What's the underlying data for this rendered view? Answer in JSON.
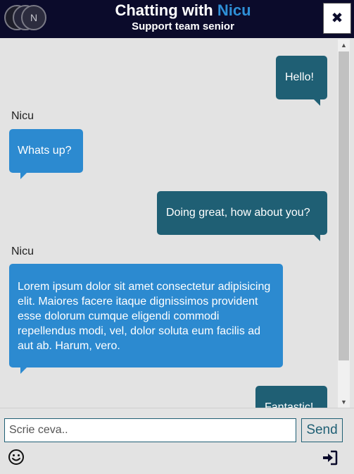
{
  "header": {
    "title_prefix": "Chatting with ",
    "title_name": "Nicu",
    "subtitle": "Support team senior",
    "avatar_initial": "N",
    "close_label": "✖"
  },
  "messages": [
    {
      "direction": "out",
      "text": "Hello!"
    },
    {
      "direction": "in",
      "sender": "Nicu",
      "text": "Whats up?"
    },
    {
      "direction": "out",
      "text": "Doing great, how about you?"
    },
    {
      "direction": "in",
      "sender": "Nicu",
      "text": "Lorem ipsum dolor sit amet consectetur adipisicing elit. Maiores facere itaque dignissimos provident esse dolorum cumque eligendi commodi repellendus modi, vel, dolor soluta eum facilis ad aut ab. Harum, vero."
    },
    {
      "direction": "out",
      "text": "Fantastic!"
    }
  ],
  "composer": {
    "placeholder": "Scrie ceva..",
    "send_label": "Send"
  },
  "icons": {
    "emoji": "smiley-icon",
    "signin": "sign-in-icon",
    "close": "close-icon"
  },
  "colors": {
    "header_bg": "#0b0b2b",
    "accent_name": "#2e8fd6",
    "outgoing_bubble": "#1f5f74",
    "incoming_bubble": "#2c8ad0",
    "chat_bg": "#e3e3e3"
  }
}
